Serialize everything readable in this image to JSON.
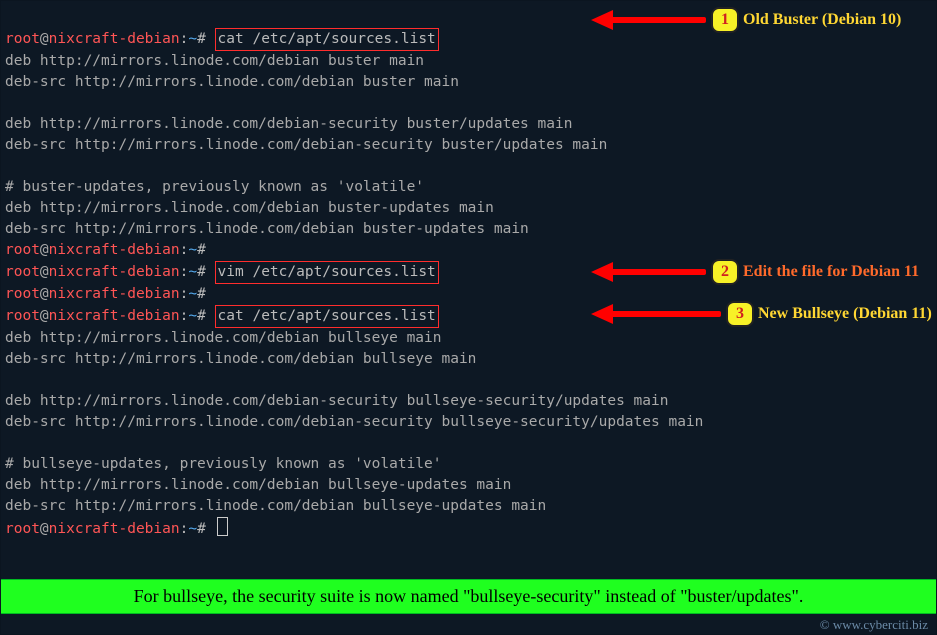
{
  "prompt": {
    "user": "root",
    "at": "@",
    "host": "nixcraft-debian",
    "sep": ":",
    "path": "~",
    "hash": "#"
  },
  "commands": {
    "cat1": "cat /etc/apt/sources.list",
    "vim": "vim /etc/apt/sources.list",
    "cat2": "cat /etc/apt/sources.list"
  },
  "lines": {
    "l01": "deb http://mirrors.linode.com/debian buster main",
    "l02": "deb-src http://mirrors.linode.com/debian buster main",
    "l03": "",
    "l04": "deb http://mirrors.linode.com/debian-security buster/updates main",
    "l05": "deb-src http://mirrors.linode.com/debian-security buster/updates main",
    "l06": "",
    "l07": "# buster-updates, previously known as 'volatile'",
    "l08": "deb http://mirrors.linode.com/debian buster-updates main",
    "l09": "deb-src http://mirrors.linode.com/debian buster-updates main",
    "l10": "deb http://mirrors.linode.com/debian bullseye main",
    "l11": "deb-src http://mirrors.linode.com/debian bullseye main",
    "l12": "",
    "l13": "deb http://mirrors.linode.com/debian-security bullseye-security/updates main",
    "l14": "deb-src http://mirrors.linode.com/debian-security bullseye-security/updates main",
    "l15": "",
    "l16": "# bullseye-updates, previously known as 'volatile'",
    "l17": "deb http://mirrors.linode.com/debian bullseye-updates main",
    "l18": "deb-src http://mirrors.linode.com/debian bullseye-updates main"
  },
  "callouts": {
    "c1": {
      "num": "1",
      "label": "Old Buster (Debian 10)"
    },
    "c2": {
      "num": "2",
      "label": "Edit the file for Debian 11"
    },
    "c3": {
      "num": "3",
      "label": "New Bullseye (Debian 11)"
    }
  },
  "banner": "For bullseye, the security suite is now named \"bullseye-security\" instead of \"buster/updates\".",
  "copyright": "©  www.cyberciti.biz"
}
